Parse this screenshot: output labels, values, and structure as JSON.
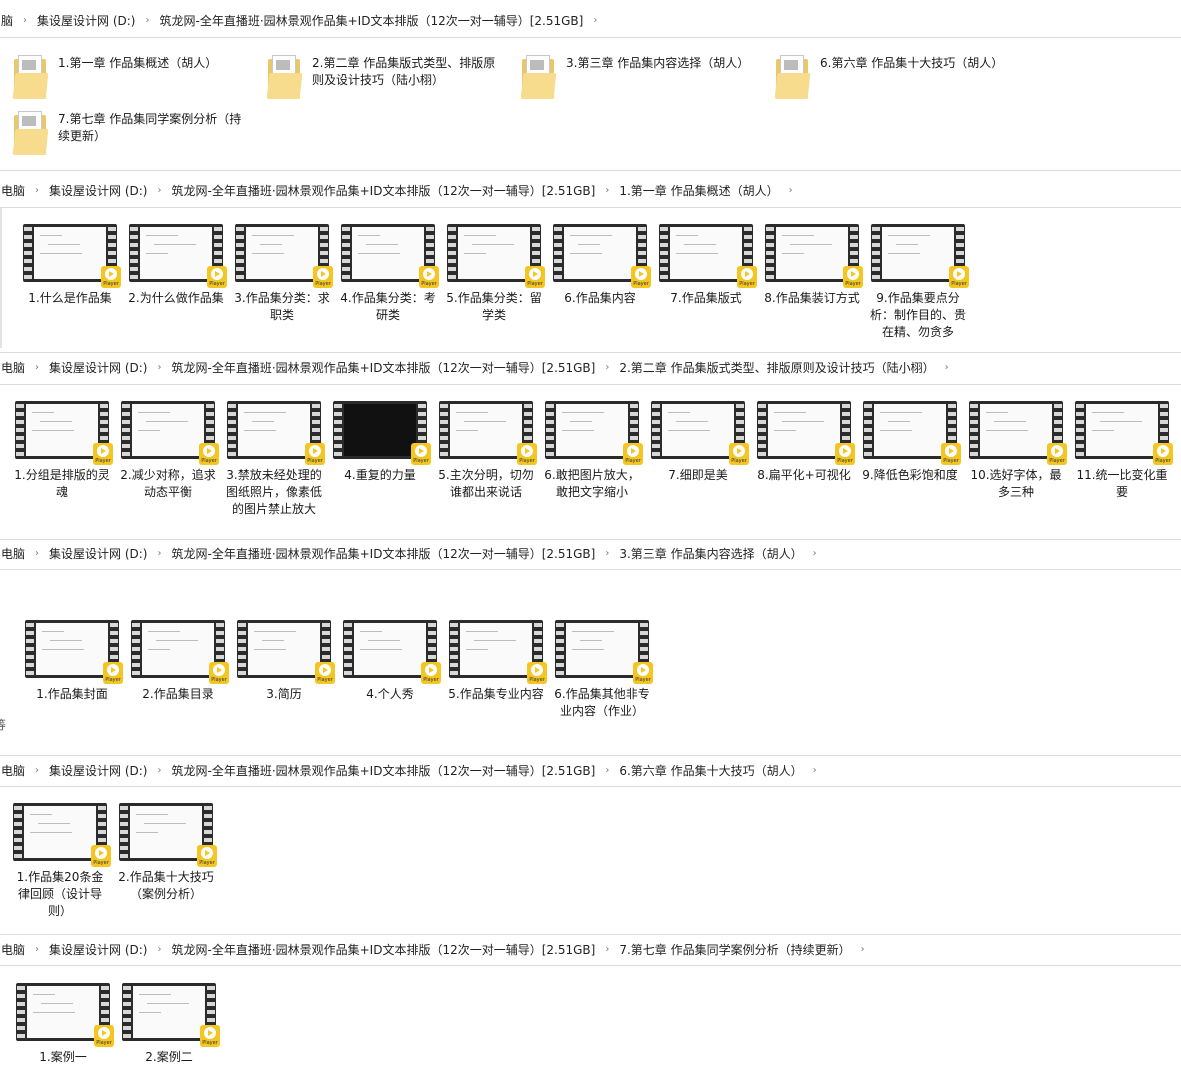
{
  "sep_glyph": "›",
  "crumbs": [
    {
      "segments": [
        "脑",
        "集设屋设计网 (D:)",
        "筑龙网-全年直播班·园林景观作品集+ID文本排版（12次一对一辅导）[2.51GB]"
      ]
    },
    {
      "segments": [
        "电脑",
        "集设屋设计网 (D:)",
        "筑龙网-全年直播班·园林景观作品集+ID文本排版（12次一对一辅导）[2.51GB]",
        "1.第一章 作品集概述（胡人）"
      ]
    },
    {
      "segments": [
        "电脑",
        "集设屋设计网 (D:)",
        "筑龙网-全年直播班·园林景观作品集+ID文本排版（12次一对一辅导）[2.51GB]",
        "2.第二章 作品集版式类型、排版原则及设计技巧（陆小栩）"
      ]
    },
    {
      "segments": [
        "电脑",
        "集设屋设计网 (D:)",
        "筑龙网-全年直播班·园林景观作品集+ID文本排版（12次一对一辅导）[2.51GB]",
        "3.第三章 作品集内容选择（胡人）"
      ]
    },
    {
      "segments": [
        "电脑",
        "集设屋设计网 (D:)",
        "筑龙网-全年直播班·园林景观作品集+ID文本排版（12次一对一辅导）[2.51GB]",
        "6.第六章 作品集十大技巧（胡人）"
      ]
    },
    {
      "segments": [
        "电脑",
        "集设屋设计网 (D:)",
        "筑龙网-全年直播班·园林景观作品集+ID文本排版（12次一对一辅导）[2.51GB]",
        "7.第七章 作品集同学案例分析（持续更新）"
      ]
    }
  ],
  "folders": [
    "1.第一章 作品集概述（胡人）",
    "2.第二章 作品集版式类型、排版原则及设计技巧（陆小栩）",
    "3.第三章 作品集内容选择（胡人）",
    "6.第六章 作品集十大技巧（胡人）",
    "7.第七章 作品集同学案例分析（持续更新）"
  ],
  "badge_label": "Player",
  "ch1": [
    "1.什么是作品集",
    "2.为什么做作品集",
    "3.作品集分类：求职类",
    "4.作品集分类：考研类",
    "5.作品集分类：留学类",
    "6.作品集内容",
    "7.作品集版式",
    "8.作品集装订方式",
    "9.作品集要点分析：制作目的、贵在精、勿贪多"
  ],
  "ch2": [
    "1.分组是排版的灵魂",
    "2.减少对称，追求动态平衡",
    "3.禁放未经处理的图纸照片，像素低的图片禁止放大",
    "4.重复的力量",
    "5.主次分明，切勿谁都出来说话",
    "6.敢把图片放大，敢把文字缩小",
    "7.细即是美",
    "8.扁平化+可视化",
    "9.降低色彩饱和度",
    "10.选好字体，最多三种",
    "11.统一比变化重要"
  ],
  "ch3": [
    "1.作品集封面",
    "2.作品集目录",
    "3.简历",
    "4.个人秀",
    "5.作品集专业内容",
    "6.作品集其他非专业内容（作业）"
  ],
  "ch6": [
    "1.作品集20条金律回顾（设计导则）",
    "2.作品集十大技巧（案例分析）"
  ],
  "ch7": [
    "1.案例一",
    "2.案例二"
  ],
  "left_edge_glyph": "等"
}
